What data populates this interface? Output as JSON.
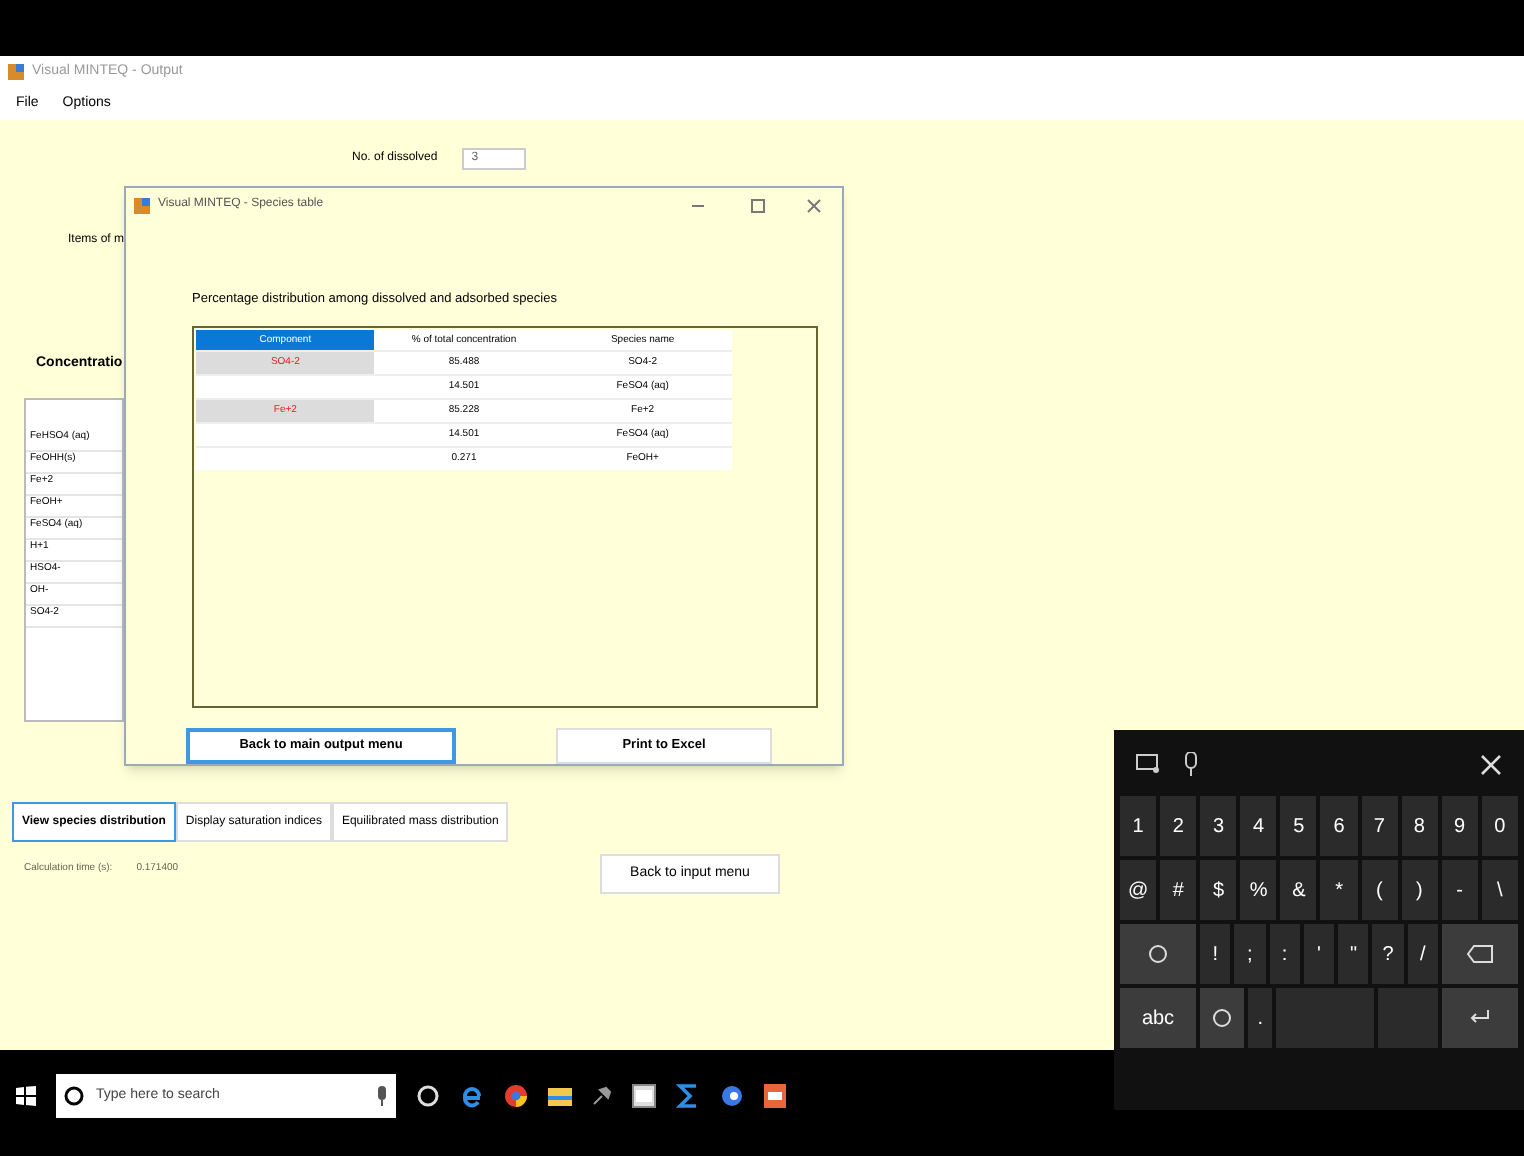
{
  "window": {
    "title": "Visual MINTEQ - Output"
  },
  "menu": [
    "File",
    "Options"
  ],
  "dissolved": {
    "label": "No. of dissolved",
    "value": "3"
  },
  "items_label": "Items of m",
  "concentration_label": "Concentratio",
  "species_list": [
    "FeHSO4 (aq)",
    "FeOHH(s)",
    "Fe+2",
    "FeOH+",
    "FeSO4 (aq)",
    "H+1",
    "HSO4-",
    "OH-",
    "SO4-2"
  ],
  "dialog": {
    "title": "Visual MINTEQ - Species table",
    "heading": "Percentage distribution among dissolved and adsorbed species",
    "columns": [
      "Component",
      "% of total concentration",
      "Species name"
    ],
    "rows": [
      {
        "component": "SO4-2",
        "percent": "85.488",
        "species": "SO4-2"
      },
      {
        "component": "",
        "percent": "14.501",
        "species": "FeSO4 (aq)"
      },
      {
        "component": "Fe+2",
        "percent": "85.228",
        "species": "Fe+2"
      },
      {
        "component": "",
        "percent": "14.501",
        "species": "FeSO4 (aq)"
      },
      {
        "component": "",
        "percent": "0.271",
        "species": "FeOH+"
      }
    ],
    "buttons": [
      {
        "label": "Back to main output menu",
        "selected": true
      },
      {
        "label": "Print to Excel",
        "selected": false
      }
    ]
  },
  "tabs": [
    {
      "label": "View species distribution",
      "selected": true
    },
    {
      "label": "Display saturation indices",
      "selected": false
    },
    {
      "label": "Equilibrated mass distribution",
      "selected": false
    }
  ],
  "calc_time": {
    "label": "Calculation time (s):",
    "value": "0.171400"
  },
  "back_button": "Back to input menu",
  "keyboard": {
    "number_keys": [
      {
        "kind": "text",
        "label": "1"
      },
      {
        "kind": "text",
        "label": "2"
      },
      {
        "kind": "text",
        "label": "3"
      },
      {
        "kind": "text",
        "label": "4"
      },
      {
        "kind": "text",
        "label": "5"
      },
      {
        "kind": "text",
        "label": "6"
      },
      {
        "kind": "text",
        "label": "7"
      },
      {
        "kind": "text",
        "label": "8"
      },
      {
        "kind": "text",
        "label": "9"
      },
      {
        "kind": "text",
        "label": "0"
      }
    ],
    "symbol_keys": [
      {
        "kind": "text",
        "label": "@"
      },
      {
        "kind": "text",
        "label": "#"
      },
      {
        "kind": "text",
        "label": "$"
      },
      {
        "kind": "text",
        "label": "%"
      },
      {
        "kind": "text",
        "label": "&"
      },
      {
        "kind": "text",
        "label": "*"
      },
      {
        "kind": "text",
        "label": "("
      },
      {
        "kind": "text",
        "label": ")"
      },
      {
        "kind": "text",
        "label": "-"
      },
      {
        "kind": "text",
        "label": "\\"
      }
    ],
    "punctuation_keys": [
      {
        "kind": "symbol"
      },
      {
        "kind": "text",
        "label": "!"
      },
      {
        "kind": "text",
        "label": ";"
      },
      {
        "kind": "text",
        "label": ":"
      },
      {
        "kind": "text",
        "label": "'"
      },
      {
        "kind": "text",
        "label": "\""
      },
      {
        "kind": "text",
        "label": "?"
      },
      {
        "kind": "text",
        "label": "/"
      },
      {
        "kind": "backspace"
      }
    ],
    "bottom_keys": [
      {
        "kind": "mode",
        "label": "abc"
      },
      {
        "kind": "emoji"
      },
      {
        "kind": "text",
        "label": "."
      },
      {
        "kind": "space"
      },
      {
        "kind": "blank"
      },
      {
        "kind": "enter"
      }
    ]
  },
  "taskbar": {
    "search_placeholder": "Type here to search"
  }
}
